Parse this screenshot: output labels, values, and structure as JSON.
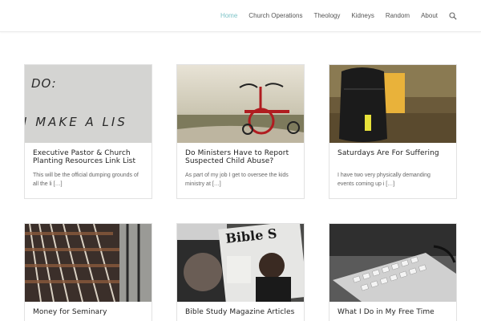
{
  "nav": {
    "items": [
      {
        "label": "Home",
        "active": true
      },
      {
        "label": "Church Operations",
        "active": false
      },
      {
        "label": "Theology",
        "active": false
      },
      {
        "label": "Kidneys",
        "active": false
      },
      {
        "label": "Random",
        "active": false
      },
      {
        "label": "About",
        "active": false
      }
    ],
    "search_icon": "search-icon",
    "active_color": "#7cc3c7"
  },
  "posts": [
    {
      "title": "Executive Pastor & Church Planting Resources Link List",
      "excerpt": "This will be the official dumping grounds of all the li […]",
      "image": "handwritten-list-photo",
      "image_text": "DO: I MAKE A LIS"
    },
    {
      "title": "Do Ministers Have to Report Suspected Child Abuse?",
      "excerpt": "As part of my job I get to oversee the kids ministry at […]",
      "image": "red-tricycle-photo"
    },
    {
      "title": "Saturdays Are For Suffering",
      "excerpt": "I have two very physically demanding events coming up i […]",
      "image": "backpack-and-bucket-photo"
    },
    {
      "title": "Money for Seminary",
      "excerpt": "",
      "image": "library-bookshelves-photo"
    },
    {
      "title": "Bible Study Magazine Articles",
      "excerpt": "",
      "image": "bible-study-magazine-photo",
      "image_text": "Bible S"
    },
    {
      "title": "What I Do in My Free Time",
      "excerpt": "",
      "image": "laptop-keyboard-photo"
    }
  ]
}
